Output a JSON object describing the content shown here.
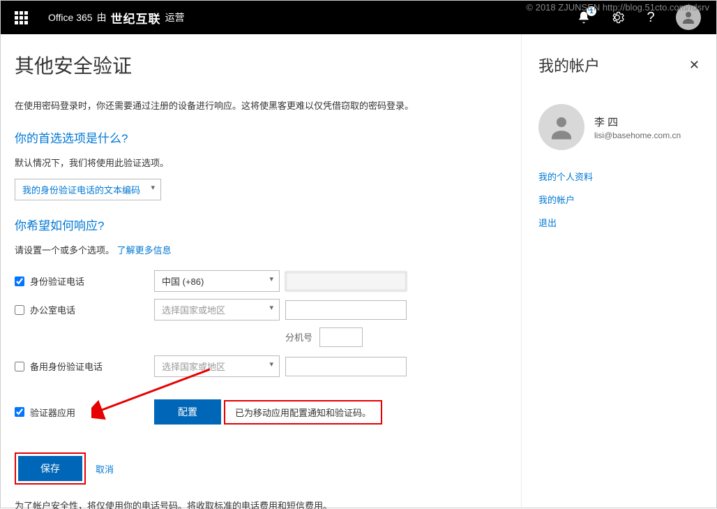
{
  "watermark": "© 2018 ZJUNSEN http://blog.51cto.com/rdsrv",
  "topbar": {
    "brand_prefix": "Office 365",
    "brand_mid": "由",
    "brand_logo": "世纪互联",
    "brand_suffix": "运营",
    "notification_count": "1"
  },
  "page": {
    "title": "其他安全验证",
    "intro": "在使用密码登录时，你还需要通过注册的设备进行响应。这将使黑客更难以仅凭借窃取的密码登录。",
    "pref_heading": "你的首选选项是什么?",
    "pref_note": "默认情况下，我们将使用此验证选项。",
    "pref_dropdown": "我的身份验证电话的文本编码",
    "respond_heading": "你希望如何响应?",
    "respond_note_prefix": "请设置一个或多个选项。",
    "respond_note_link": "了解更多信息",
    "rows": {
      "auth_phone": "身份验证电话",
      "office_phone": "办公室电话",
      "backup_phone": "备用身份验证电话",
      "authenticator": "验证器应用"
    },
    "country_china": "中国 (+86)",
    "country_placeholder": "选择国家或地区",
    "ext_label": "分机号",
    "configure_btn": "配置",
    "config_status": "已为移动应用配置通知和验证码。",
    "save_btn": "保存",
    "cancel": "取消",
    "footer": "为了帐户安全性，将仅使用你的电话号码。将收取标准的电话费用和短信费用。"
  },
  "sidebar": {
    "title": "我的帐户",
    "user_name": "李 四",
    "user_email": "lisi@basehome.com.cn",
    "link_profile": "我的个人资料",
    "link_account": "我的帐户",
    "link_signout": "退出"
  }
}
